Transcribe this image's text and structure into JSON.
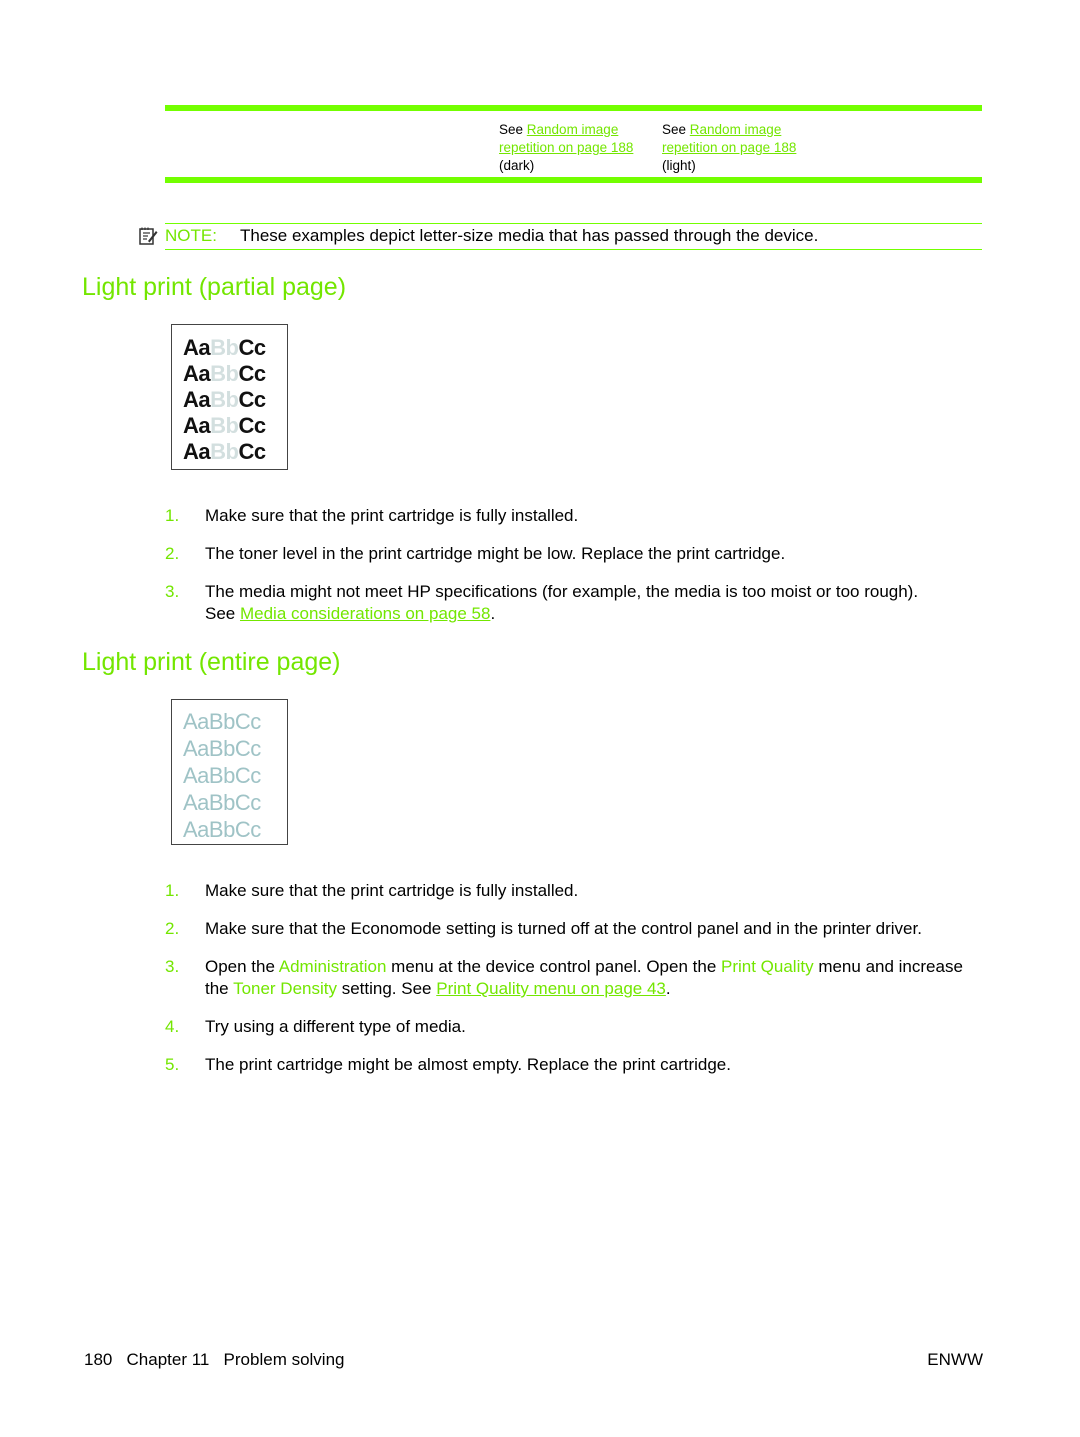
{
  "table": {
    "cells": [
      {
        "prefix": "See ",
        "link": "Random image repetition on page 188",
        "suffix": "(dark)"
      },
      {
        "prefix": "See ",
        "link": "Random image repetition on page 188",
        "suffix": "(light)"
      }
    ]
  },
  "note": {
    "icon": "note-icon",
    "label": "NOTE:",
    "text": "These examples depict letter-size media that has passed through the device."
  },
  "sections": [
    {
      "title": "Light print (partial page)",
      "sample": {
        "rows": [
          "AaBbCc",
          "AaBbCc",
          "AaBbCc",
          "AaBbCc",
          "AaBbCc"
        ],
        "start": "Aa",
        "mid": "Bb",
        "end": "Cc"
      },
      "steps": [
        {
          "num": "1.",
          "text": "Make sure that the print cartridge is fully installed."
        },
        {
          "num": "2.",
          "text": "The toner level in the print cartridge might be low. Replace the print cartridge."
        },
        {
          "num": "3.",
          "text": "The media might not meet HP specifications (for example, the media is too moist or too rough).",
          "line2_prefix": "See ",
          "link": "Media considerations on page 58",
          "line2_suffix": "."
        }
      ]
    },
    {
      "title": "Light print (entire page)",
      "sample": {
        "rows": [
          "AaBbCc",
          "AaBbCc",
          "AaBbCc",
          "AaBbCc",
          "AaBbCc"
        ]
      },
      "steps": [
        {
          "num": "1.",
          "text": "Make sure that the print cartridge is fully installed."
        },
        {
          "num": "2.",
          "text": "Make sure that the Economode setting is turned off at the control panel and in the printer driver."
        },
        {
          "num": "3.",
          "p1": "Open the ",
          "menu1": "Administration",
          "p2": " menu at the device control panel. Open the ",
          "menu2": "Print Quality",
          "p3": " menu and increase the ",
          "menu3": "Toner Density",
          "p4": " setting. See ",
          "link": "Print Quality menu on page 43",
          "p5": "."
        },
        {
          "num": "4.",
          "text": "Try using a different type of media."
        },
        {
          "num": "5.",
          "text": "The print cartridge might be almost empty. Replace the print cartridge."
        }
      ]
    }
  ],
  "footer": {
    "left": "180   Chapter 11   Problem solving",
    "right": "ENWW"
  },
  "colors": {
    "accent": "#73ff00",
    "accent_text": "#73e600"
  }
}
